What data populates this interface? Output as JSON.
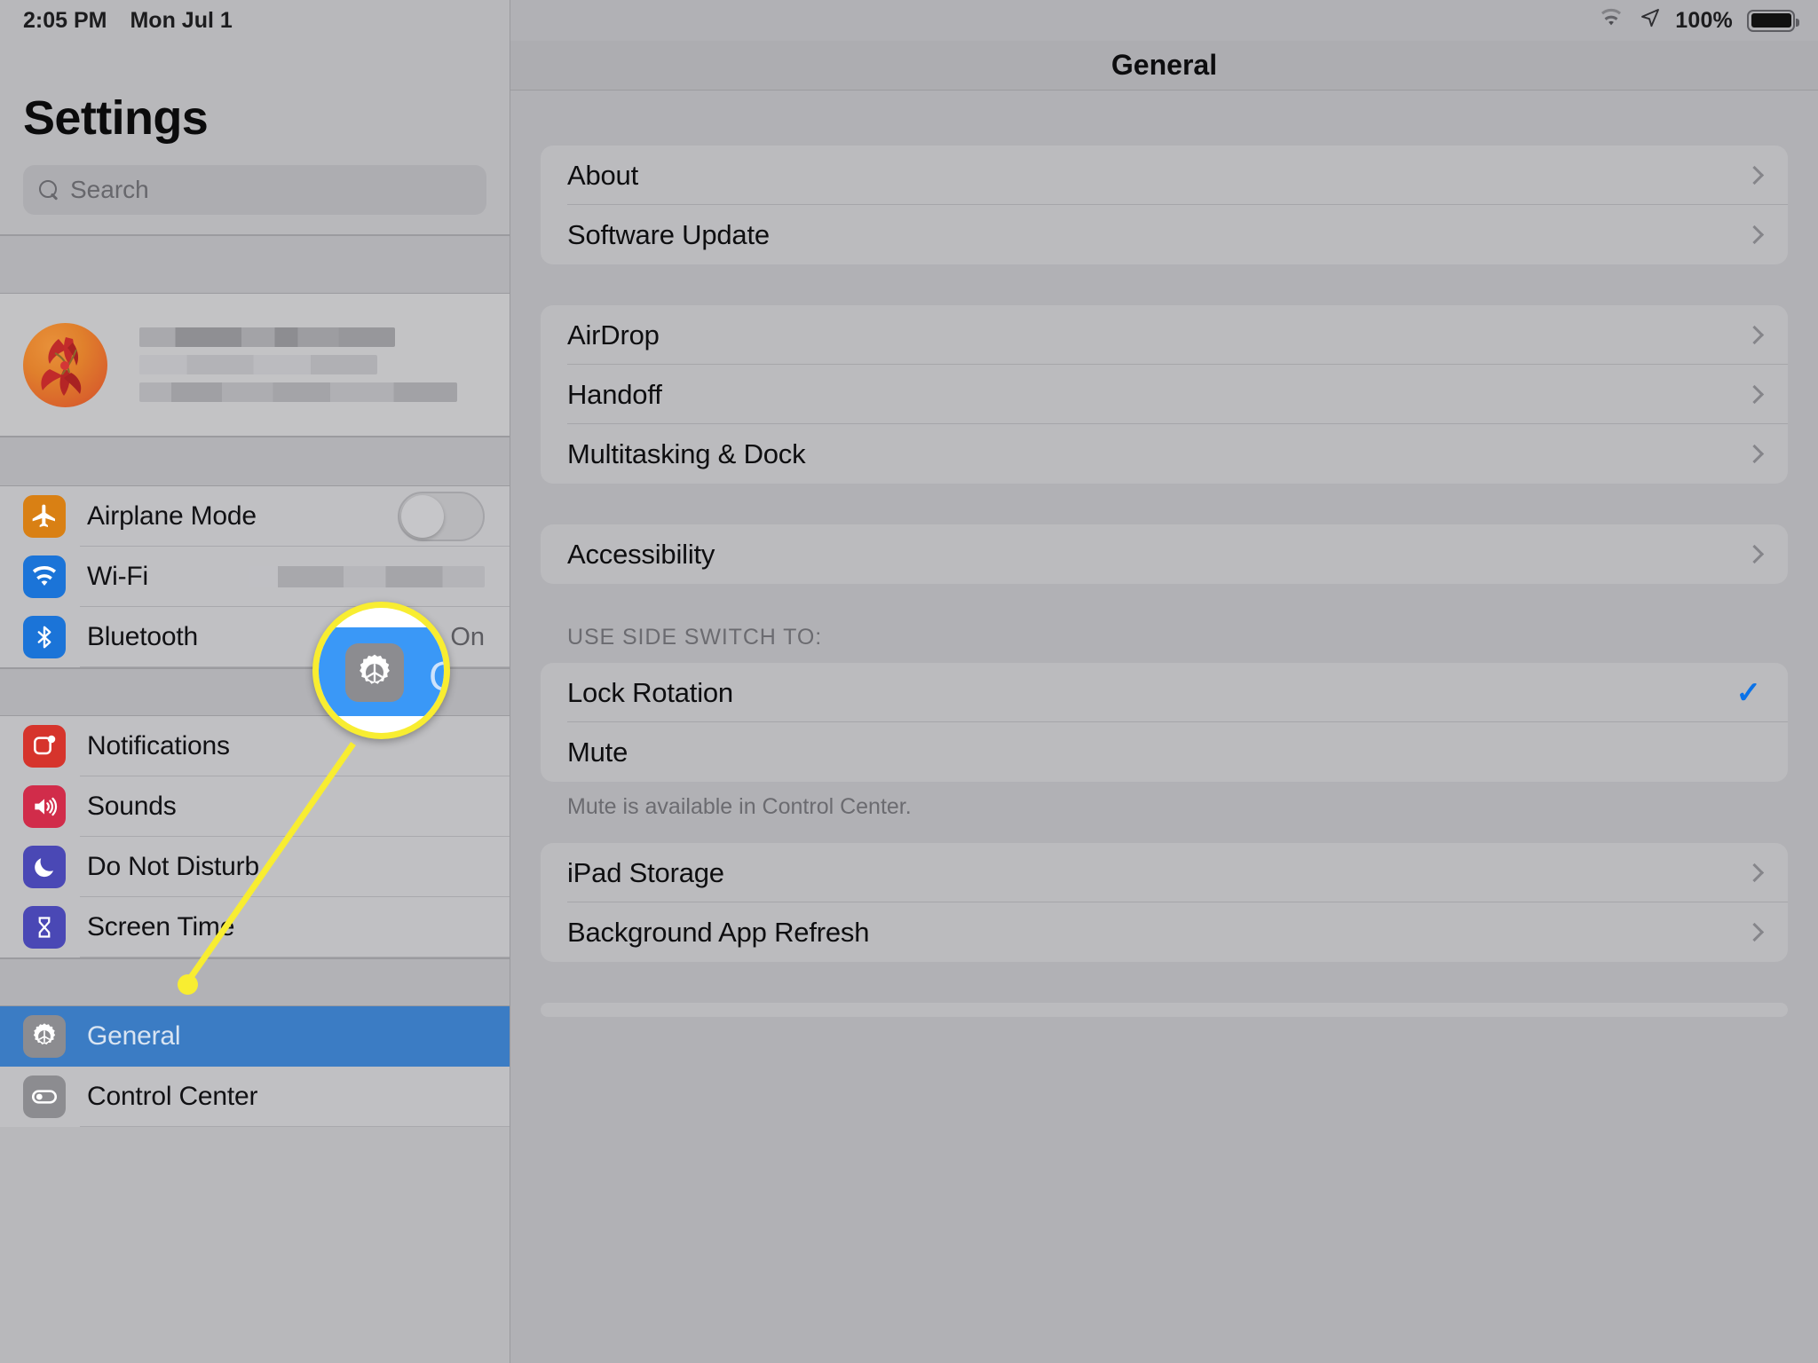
{
  "statusbar": {
    "time": "2:05 PM",
    "date": "Mon Jul 1",
    "battery_percent": "100%",
    "wifi_icon": "wifi-icon",
    "location_icon": "location-arrow-icon",
    "battery_icon": "battery-full-icon"
  },
  "sidebar": {
    "title": "Settings",
    "search": {
      "placeholder": "Search",
      "value": "",
      "icon": "search-icon"
    },
    "account": {
      "name_redacted": "",
      "subtitle_redacted": "",
      "avatar_icon": "avatar-flower-photo"
    },
    "items": [
      {
        "label": "Airplane Mode",
        "icon": "airplane-icon",
        "color": "#d98014",
        "control": "toggle",
        "toggle_on": false
      },
      {
        "label": "Wi-Fi",
        "icon": "wifi-icon",
        "color": "#1b74d8",
        "control": "redacted-value",
        "value": ""
      },
      {
        "label": "Bluetooth",
        "icon": "bluetooth-icon",
        "color": "#1b74d8",
        "control": "value",
        "value": "On"
      },
      {
        "label": "Notifications",
        "icon": "notifications-icon",
        "color": "#d6342c",
        "control": "none",
        "value": ""
      },
      {
        "label": "Sounds",
        "icon": "sounds-speaker-icon",
        "color": "#d12c4a",
        "control": "none",
        "value": ""
      },
      {
        "label": "Do Not Disturb",
        "icon": "moon-icon",
        "color": "#4a48b5",
        "control": "none",
        "value": ""
      },
      {
        "label": "Screen Time",
        "icon": "hourglass-icon",
        "color": "#4a48b5",
        "control": "none",
        "value": ""
      },
      {
        "label": "General",
        "icon": "gear-icon",
        "color": "#8c8c90",
        "control": "none",
        "value": "",
        "selected": true
      },
      {
        "label": "Control Center",
        "icon": "control-center-toggle-icon",
        "color": "#8c8c90",
        "control": "none",
        "value": ""
      }
    ]
  },
  "detail": {
    "title": "General",
    "groups": [
      {
        "header": "",
        "footer": "",
        "rows": [
          {
            "label": "About",
            "accessory": "chevron"
          },
          {
            "label": "Software Update",
            "accessory": "chevron"
          }
        ]
      },
      {
        "header": "",
        "footer": "",
        "rows": [
          {
            "label": "AirDrop",
            "accessory": "chevron"
          },
          {
            "label": "Handoff",
            "accessory": "chevron"
          },
          {
            "label": "Multitasking & Dock",
            "accessory": "chevron"
          }
        ]
      },
      {
        "header": "",
        "footer": "",
        "rows": [
          {
            "label": "Accessibility",
            "accessory": "chevron"
          }
        ]
      },
      {
        "header": "USE SIDE SWITCH TO:",
        "footer": "Mute is available in Control Center.",
        "rows": [
          {
            "label": "Lock Rotation",
            "accessory": "checkmark"
          },
          {
            "label": "Mute",
            "accessory": "none"
          }
        ]
      },
      {
        "header": "",
        "footer": "",
        "rows": [
          {
            "label": "iPad Storage",
            "accessory": "chevron"
          },
          {
            "label": "Background App Refresh",
            "accessory": "chevron"
          }
        ]
      }
    ]
  },
  "callout": {
    "magnifier_label": "G",
    "magnifier_icon": "gear-icon",
    "highlight_color": "#f8ed31",
    "selected_row_color": "#3a98f7"
  }
}
